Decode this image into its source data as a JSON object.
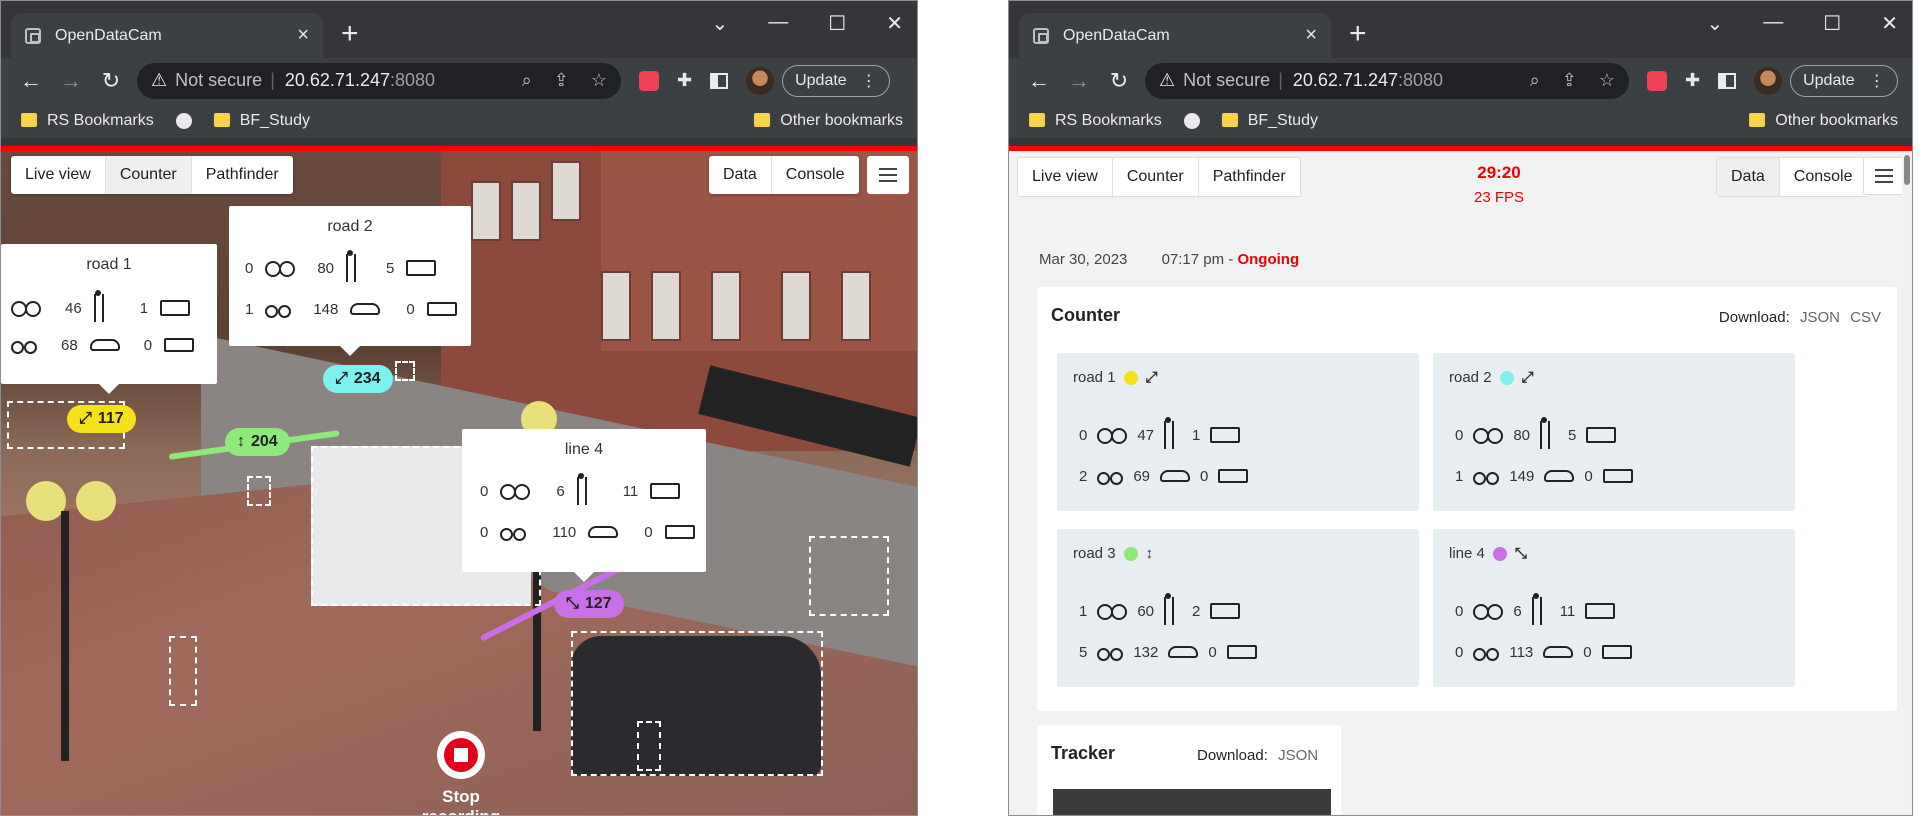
{
  "browser": {
    "tab_title": "OpenDataCam",
    "not_secure": "Not secure",
    "host": "20.62.71.247",
    "port": ":8080",
    "update_label": "Update",
    "bookmarks": [
      "RS Bookmarks",
      "BF_Study"
    ],
    "other_bookmarks": "Other bookmarks"
  },
  "left": {
    "nav": [
      "Live view",
      "Counter",
      "Pathfinder"
    ],
    "right_nav": [
      "Data",
      "Console"
    ],
    "stop_recording": "Stop recording",
    "cards": [
      {
        "name": "road 1",
        "bike": "46",
        "ped": "46",
        "truck": "1",
        "moto": "68",
        "car": "68",
        "bus": "0",
        "raw": [
          "",
          "46",
          "1",
          "",
          "68",
          "0"
        ]
      },
      {
        "name": "road 2",
        "bike": "0",
        "ped": "80",
        "truck": "5",
        "moto": "1",
        "car": "148",
        "bus": "0"
      },
      {
        "name": "line 4",
        "bike": "0",
        "ped": "6",
        "truck": "11",
        "moto": "0",
        "car": "110",
        "bus": "0"
      }
    ],
    "road1_row": [
      "46",
      "1",
      "68",
      "0"
    ],
    "pills": [
      {
        "value": "117",
        "color": "#f5e11a"
      },
      {
        "value": "234",
        "color": "#7ef0f0"
      },
      {
        "value": "204",
        "color": "#8fe87a"
      },
      {
        "value": "127",
        "color": "#c770e8"
      }
    ]
  },
  "right": {
    "nav": [
      "Live view",
      "Counter",
      "Pathfinder"
    ],
    "right_nav": [
      "Data",
      "Console"
    ],
    "timer": "29:20",
    "fps": "23 FPS",
    "date": "Mar 30, 2023",
    "time": "07:17 pm -",
    "status": "Ongoing",
    "counter_title": "Counter",
    "download_label": "Download:",
    "download_json": "JSON",
    "download_csv": "CSV",
    "tracker_title": "Tracker",
    "roads": [
      {
        "name": "road 1",
        "color": "#f5e11a",
        "arrow": "⤢",
        "bike": "0",
        "ped": "47",
        "truck": "1",
        "moto": "2",
        "car": "69",
        "bus": "0"
      },
      {
        "name": "road 2",
        "color": "#7ef0f0",
        "arrow": "⤢",
        "bike": "0",
        "ped": "80",
        "truck": "5",
        "moto": "1",
        "car": "149",
        "bus": "0"
      },
      {
        "name": "road 3",
        "color": "#8fe87a",
        "arrow": "↕",
        "bike": "1",
        "ped": "60",
        "truck": "2",
        "moto": "5",
        "car": "132",
        "bus": "0"
      },
      {
        "name": "line 4",
        "color": "#c770e8",
        "arrow": "⤡",
        "bike": "0",
        "ped": "6",
        "truck": "11",
        "moto": "0",
        "car": "113",
        "bus": "0"
      }
    ]
  }
}
